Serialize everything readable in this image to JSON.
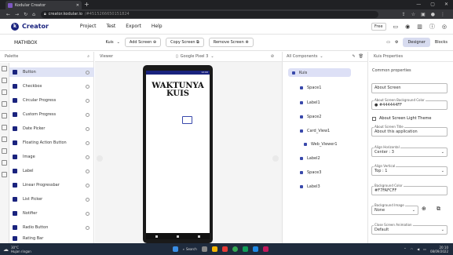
{
  "browser": {
    "tab_title": "Kodular Creator",
    "url_host": "creator.kodular.io",
    "url_path": "/#4515266650151824"
  },
  "app": {
    "brand": "Creator",
    "menu": [
      "Project",
      "Test",
      "Export",
      "Help"
    ],
    "free_label": "Free"
  },
  "toolbar": {
    "project_name": "MATHBOX",
    "screen": "Kuis",
    "add_screen": "Add Screen ⊕",
    "copy_screen": "Copy Screen ⧉",
    "remove_screen": "Remove Screen ⊗",
    "designer": "Designer",
    "blocks": "Blocks"
  },
  "palette": {
    "title": "Palette",
    "items": [
      "Button",
      "Checkbox",
      "Circular Progress",
      "Custom Progress",
      "Date Picker",
      "Floating Action Button",
      "Image",
      "Label",
      "Linear Progressbar",
      "List Picker",
      "Notifier",
      "Radio Button",
      "Rating Bar"
    ]
  },
  "viewer": {
    "title": "Viewer",
    "device": "Google Pixel 3",
    "status_time": "12:00",
    "phone_title_line1": "WAKTUNYA",
    "phone_title_line2": "KUIS"
  },
  "components": {
    "title": "All Components",
    "items": [
      "Kuis",
      "Space1",
      "Label1",
      "Space2",
      "Card_View1",
      "Web_Viewer1",
      "Label2",
      "Space3",
      "Label3"
    ]
  },
  "properties": {
    "title": "Kuis Properties",
    "common": "Common properties",
    "about_screen": "About Screen",
    "bg_color_label": "About Screen Background Color",
    "bg_color_value": "#444444FF",
    "light_theme": "About Screen Light Theme",
    "title_label": "About Screen Title",
    "title_value": "About this application",
    "align_h_label": "Align Horizontal",
    "align_h_value": "Center : 3",
    "align_v_label": "Align Vertical",
    "align_v_value": "Top : 1",
    "bgcolor_label": "Background Color",
    "bgcolor_value": "#F7FAFCFF",
    "bgimage_label": "Background Image",
    "bgimage_value": "None",
    "anim_label": "Close Screen Animation",
    "anim_value": "Default"
  },
  "taskbar": {
    "temp": "30°C",
    "weather": "Hujan ringan",
    "search": "Search",
    "time": "20:10",
    "date": "08/09/2022"
  },
  "colors": {
    "accent": "#1a237e",
    "selected": "#dde0f6"
  }
}
